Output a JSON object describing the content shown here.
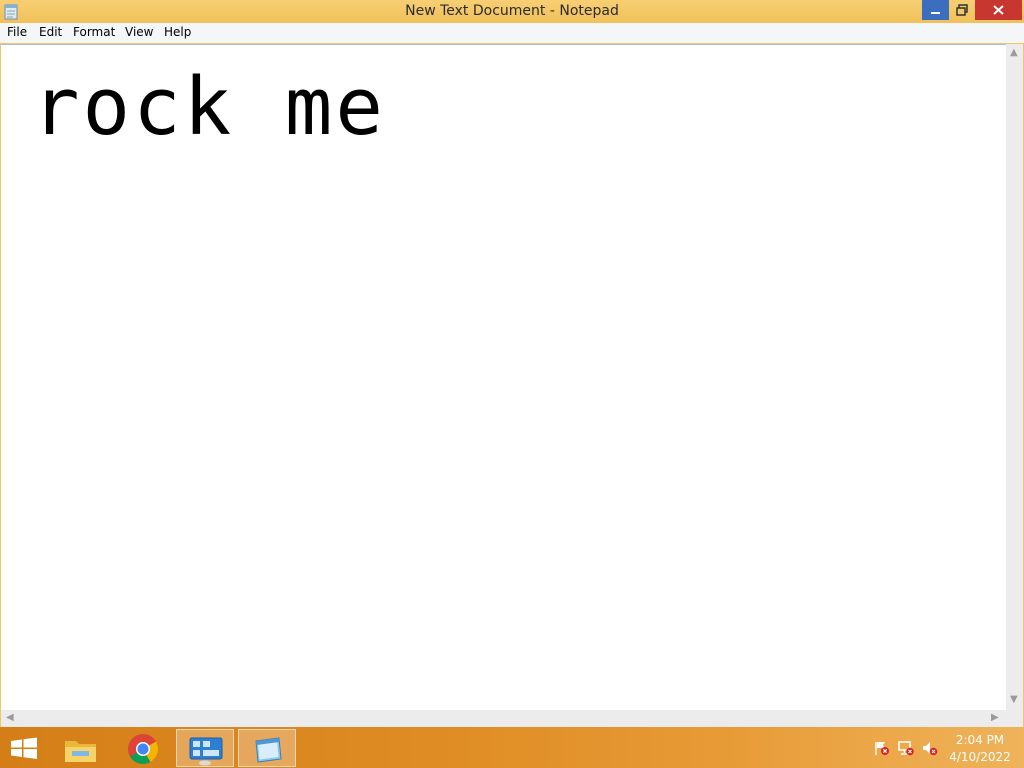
{
  "window": {
    "title": "New Text Document - Notepad",
    "title_bar_color": "#f0c05a"
  },
  "menu": {
    "items": [
      "File",
      "Edit",
      "Format",
      "View",
      "Help"
    ]
  },
  "editor": {
    "content": "rock me"
  },
  "taskbar": {
    "apps": [
      {
        "icon": "windows-start-icon",
        "active": false
      },
      {
        "icon": "file-explorer-icon",
        "active": false
      },
      {
        "icon": "chrome-icon",
        "active": false
      },
      {
        "icon": "control-panel-icon",
        "active": true
      },
      {
        "icon": "notepad-icon",
        "active": true
      }
    ],
    "tray": [
      "action-center-flag-icon",
      "network-icon",
      "volume-muted-icon"
    ],
    "clock": {
      "time": "2:04 PM",
      "date": "4/10/2022"
    }
  },
  "colors": {
    "accent": "#3c6ebf",
    "close": "#c7372f",
    "taskbar": "#e08d25"
  }
}
